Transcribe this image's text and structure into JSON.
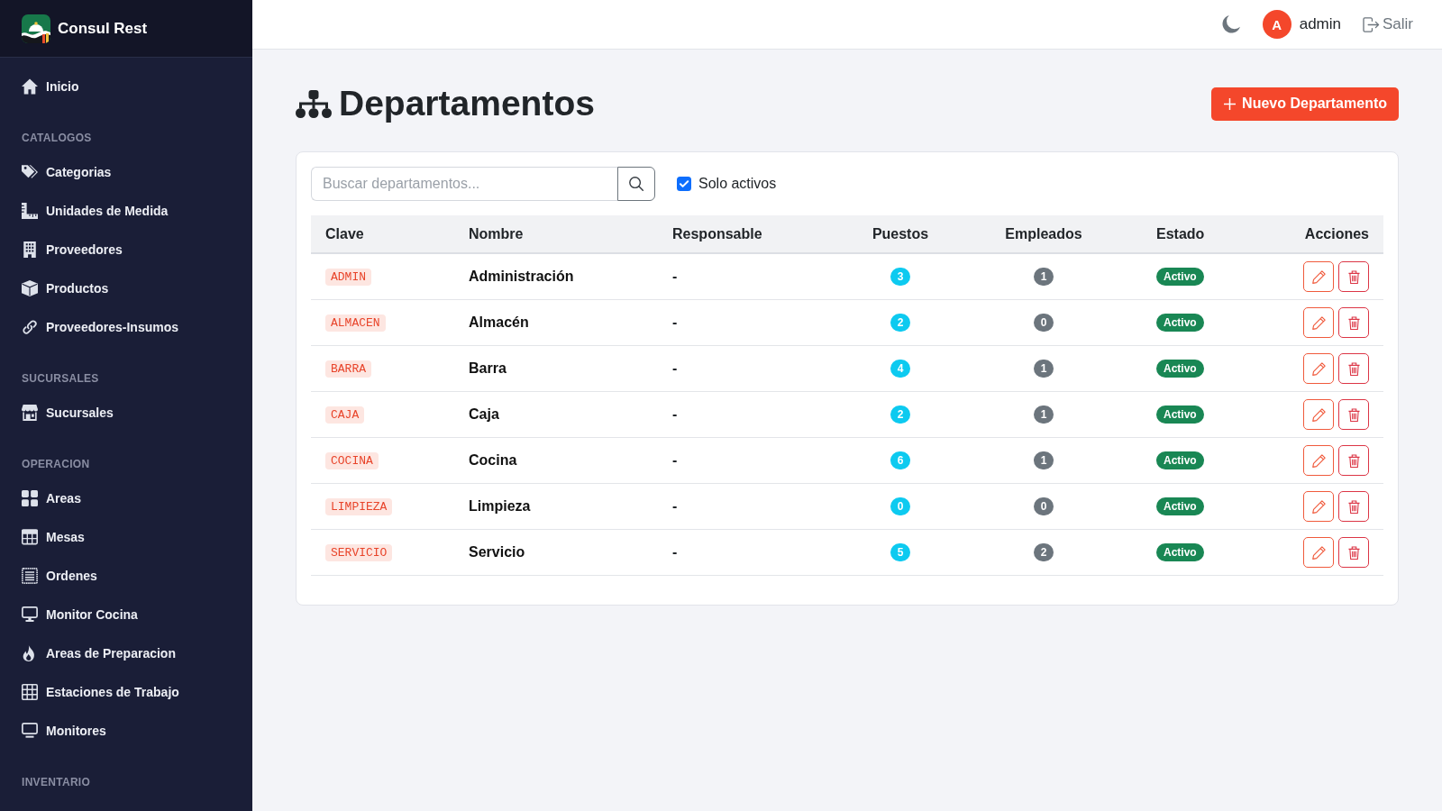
{
  "sidebar": {
    "brand": "Consul Rest",
    "sections": [
      {
        "items": [
          {
            "label": "Inicio"
          }
        ]
      },
      {
        "heading": "CATALOGOS",
        "items": [
          {
            "label": "Categorias"
          },
          {
            "label": "Unidades de Medida"
          },
          {
            "label": "Proveedores"
          },
          {
            "label": "Productos"
          },
          {
            "label": "Proveedores-Insumos"
          }
        ]
      },
      {
        "heading": "SUCURSALES",
        "items": [
          {
            "label": "Sucursales"
          }
        ]
      },
      {
        "heading": "OPERACION",
        "items": [
          {
            "label": "Areas"
          },
          {
            "label": "Mesas"
          },
          {
            "label": "Ordenes"
          },
          {
            "label": "Monitor Cocina"
          },
          {
            "label": "Areas de Preparacion"
          },
          {
            "label": "Estaciones de Trabajo"
          },
          {
            "label": "Monitores"
          }
        ]
      },
      {
        "heading": "INVENTARIO"
      }
    ]
  },
  "top_bar": {
    "user": {
      "initial": "A",
      "name": "admin"
    },
    "logout": "Salir"
  },
  "page": {
    "title": "Departamentos",
    "new_button": "Nuevo Departamento"
  },
  "filters": {
    "search": {
      "placeholder": "Buscar departamentos..."
    },
    "active_only": {
      "label": "Solo activos",
      "checked": true
    }
  },
  "table": {
    "columns": [
      "Clave",
      "Nombre",
      "Responsable",
      "Puestos",
      "Empleados",
      "Estado",
      "Acciones"
    ],
    "rows": [
      {
        "code": "ADMIN",
        "name": "Administración",
        "manager": "-",
        "positions": "3",
        "employees": "1",
        "status": "Activo",
        "active": true
      },
      {
        "code": "ALMACEN",
        "name": "Almacén",
        "manager": "-",
        "positions": "2",
        "employees": "0",
        "status": "Activo",
        "active": true
      },
      {
        "code": "BARRA",
        "name": "Barra",
        "manager": "-",
        "positions": "4",
        "employees": "1",
        "status": "Activo",
        "active": true
      },
      {
        "code": "CAJA",
        "name": "Caja",
        "manager": "-",
        "positions": "2",
        "employees": "1",
        "status": "Activo",
        "active": true
      },
      {
        "code": "COCINA",
        "name": "Cocina",
        "manager": "-",
        "positions": "6",
        "employees": "1",
        "status": "Activo",
        "active": true
      },
      {
        "code": "LIMPIEZA",
        "name": "Limpieza",
        "manager": "-",
        "positions": "0",
        "employees": "0",
        "status": "Activo",
        "active": true
      },
      {
        "code": "SERVICIO",
        "name": "Servicio",
        "manager": "-",
        "positions": "5",
        "employees": "2",
        "status": "Activo",
        "active": true
      }
    ]
  }
}
